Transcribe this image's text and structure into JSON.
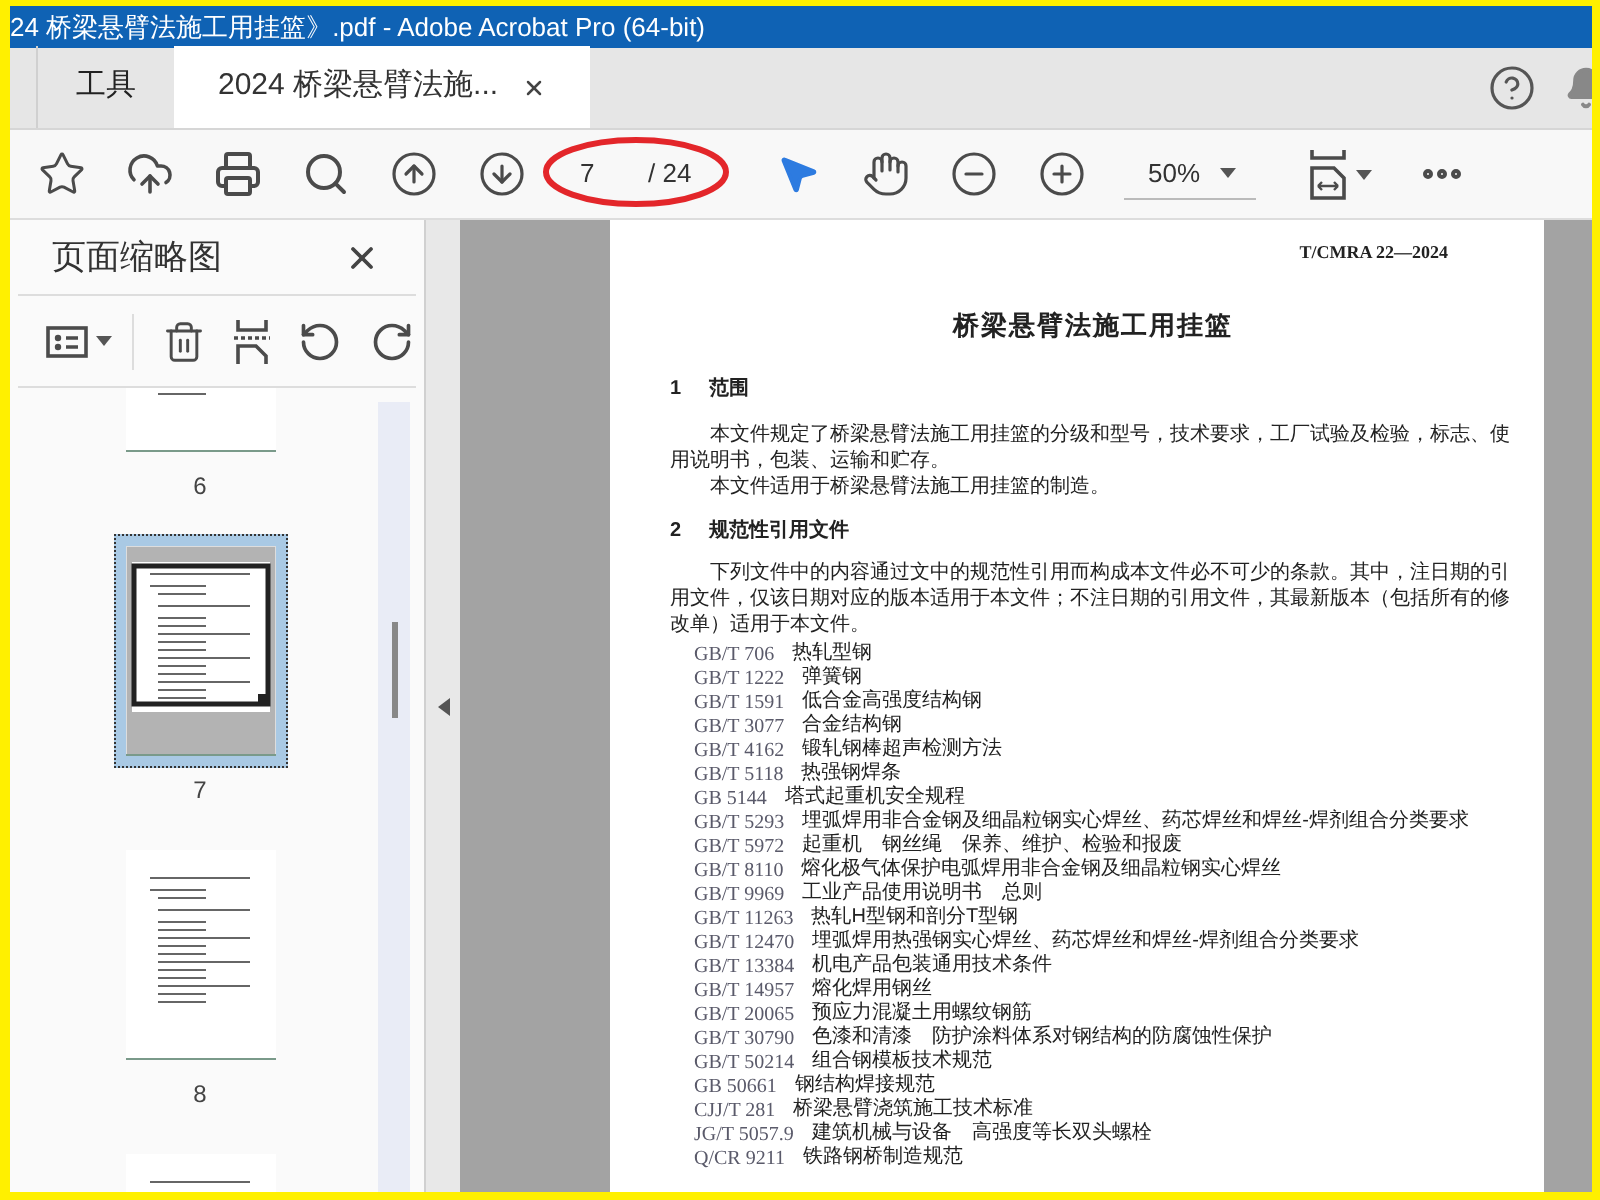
{
  "window": {
    "title": "24 桥梁悬臂法施工用挂篮》.pdf - Adobe Acrobat Pro (64-bit)"
  },
  "tabs": [
    {
      "label": "工具",
      "selected": false,
      "closable": false
    },
    {
      "label": "2024 桥梁悬臂法施...",
      "selected": true,
      "closable": true
    }
  ],
  "toolbar": {
    "page_number": "7",
    "page_total": "/ 24",
    "zoom": "50%"
  },
  "thumbnails_panel": {
    "title": "页面缩略图",
    "pages": [
      {
        "label": "6",
        "selected": false
      },
      {
        "label": "7",
        "selected": true
      },
      {
        "label": "8",
        "selected": false
      },
      {
        "selected": false
      }
    ]
  },
  "document": {
    "header": "T/CMRA 22—2024",
    "title": "桥梁悬臂法施工用挂篮",
    "sections": [
      {
        "number": "1",
        "heading": "范围",
        "paragraphs": [
          "本文件规定了桥梁悬臂法施工用挂篮的分级和型号，技术要求，工厂试验及检验，标志、使用说明书，包装、运输和贮存。",
          "本文件适用于桥梁悬臂法施工用挂篮的制造。"
        ]
      },
      {
        "number": "2",
        "heading": "规范性引用文件",
        "paragraphs": [
          "下列文件中的内容通过文中的规范性引用而构成本文件必不可少的条款。其中，注日期的引用文件，仅该日期对应的版本适用于本文件；不注日期的引用文件，其最新版本（包括所有的修改单）适用于本文件。"
        ],
        "references": [
          {
            "code": "GB/T 706",
            "title": "热轧型钢"
          },
          {
            "code": "GB/T 1222",
            "title": "弹簧钢"
          },
          {
            "code": "GB/T 1591",
            "title": "低合金高强度结构钢"
          },
          {
            "code": "GB/T 3077",
            "title": "合金结构钢"
          },
          {
            "code": "GB/T 4162",
            "title": "锻轧钢棒超声检测方法"
          },
          {
            "code": "GB/T 5118",
            "title": "热强钢焊条"
          },
          {
            "code": "GB 5144",
            "title": "塔式起重机安全规程"
          },
          {
            "code": "GB/T 5293",
            "title": "埋弧焊用非合金钢及细晶粒钢实心焊丝、药芯焊丝和焊丝-焊剂组合分类要求"
          },
          {
            "code": "GB/T 5972",
            "title": "起重机　钢丝绳　保养、维护、检验和报废"
          },
          {
            "code": "GB/T 8110",
            "title": "熔化极气体保护电弧焊用非合金钢及细晶粒钢实心焊丝"
          },
          {
            "code": "GB/T 9969",
            "title": "工业产品使用说明书　总则"
          },
          {
            "code": "GB/T 11263",
            "title": "热轧H型钢和剖分T型钢"
          },
          {
            "code": "GB/T 12470",
            "title": "埋弧焊用热强钢实心焊丝、药芯焊丝和焊丝-焊剂组合分类要求"
          },
          {
            "code": "GB/T 13384",
            "title": "机电产品包装通用技术条件"
          },
          {
            "code": "GB/T 14957",
            "title": "熔化焊用钢丝"
          },
          {
            "code": "GB/T 20065",
            "title": "预应力混凝土用螺纹钢筋"
          },
          {
            "code": "GB/T 30790",
            "title": "色漆和清漆　防护涂料体系对钢结构的防腐蚀性保护"
          },
          {
            "code": "GB/T 50214",
            "title": "组合钢模板技术规范"
          },
          {
            "code": "GB 50661",
            "title": "钢结构焊接规范"
          },
          {
            "code": "CJJ/T 281",
            "title": "桥梁悬臂浇筑施工技术标准"
          },
          {
            "code": "JG/T 5057.9",
            "title": "建筑机械与设备　高强度等长双头螺栓"
          },
          {
            "code": "Q/CR 9211",
            "title": "铁路钢桥制造规范"
          }
        ]
      }
    ]
  }
}
